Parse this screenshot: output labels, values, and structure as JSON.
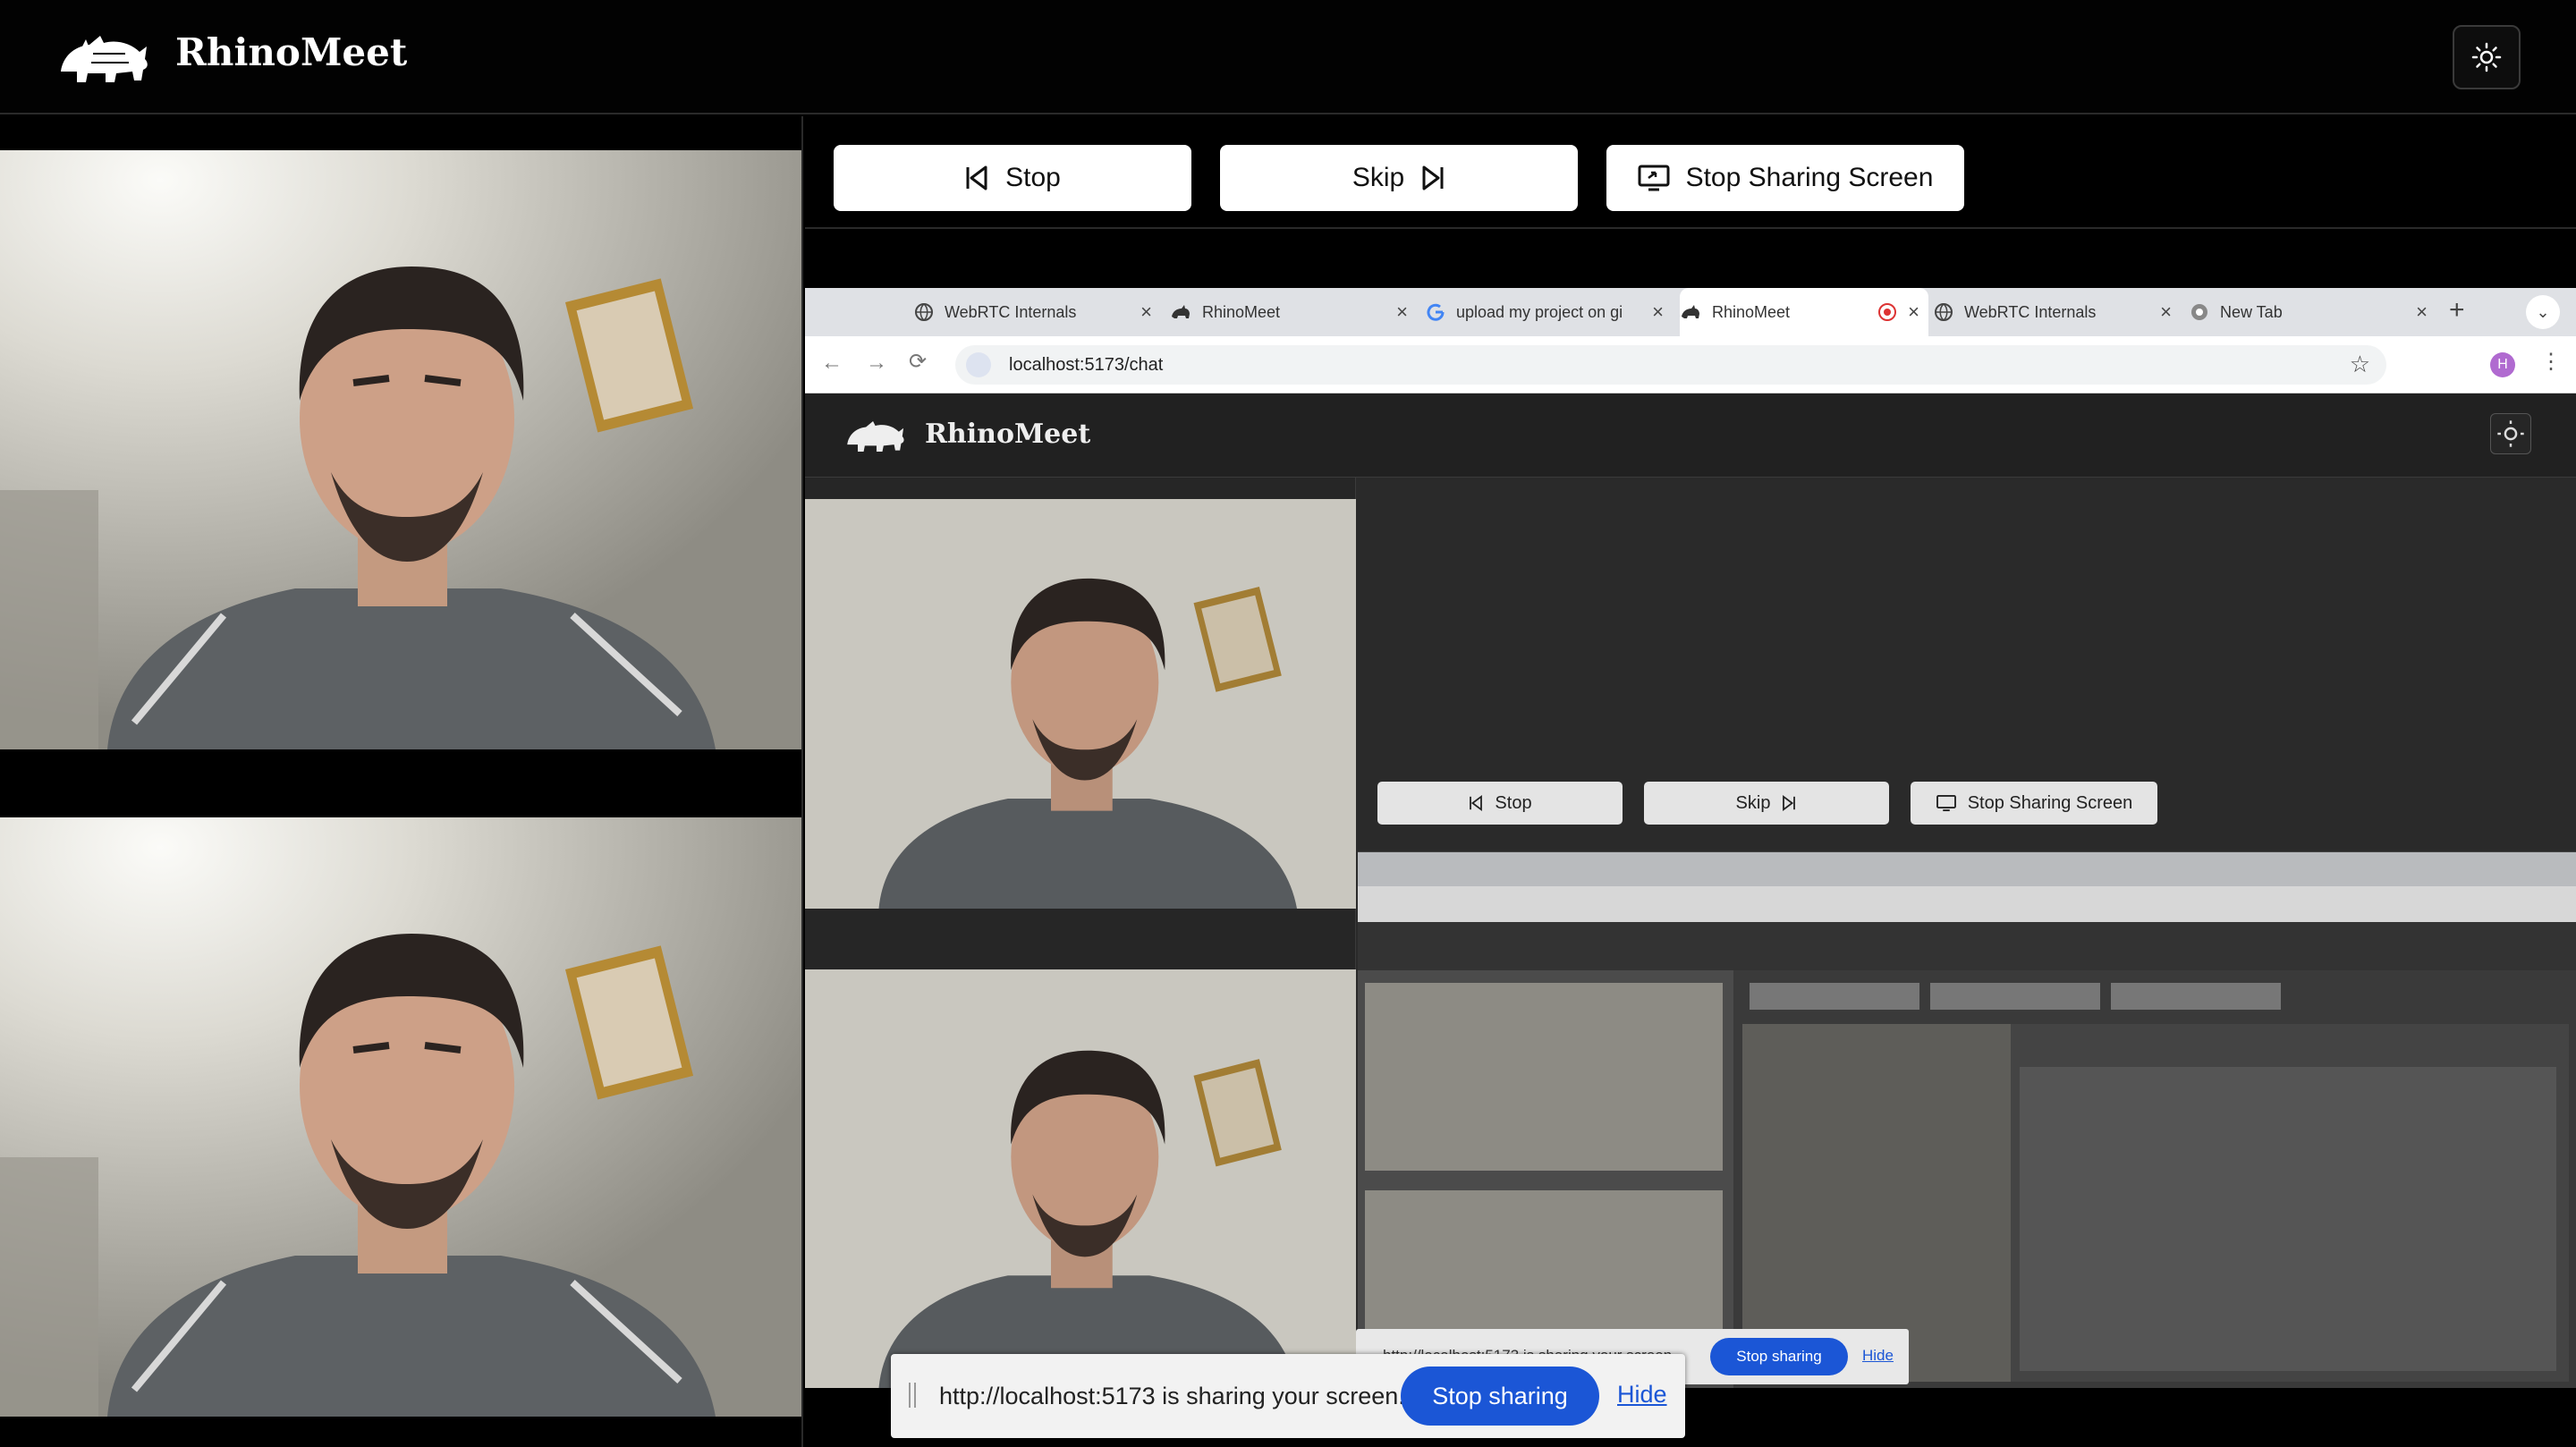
{
  "app": {
    "name": "RhinoMeet"
  },
  "controls": {
    "stop_label": "Stop",
    "skip_label": "Skip",
    "stop_share_label": "Stop Sharing Screen"
  },
  "browser": {
    "tabs": [
      {
        "label": "WebRTC Internals",
        "icon": "globe-icon"
      },
      {
        "label": "RhinoMeet",
        "icon": "rhino-icon"
      },
      {
        "label": "upload my project on gi",
        "icon": "google-icon"
      },
      {
        "label": "RhinoMeet",
        "icon": "rhino-icon"
      },
      {
        "label": "WebRTC Internals",
        "icon": "globe-icon"
      },
      {
        "label": "New Tab",
        "icon": "chrome-icon"
      }
    ],
    "url": "localhost:5173/chat",
    "profile_initial": "H"
  },
  "share_notification": {
    "text": "http://localhost:5173 is sharing your screen.",
    "stop_label": "Stop sharing",
    "hide_label": "Hide"
  },
  "colors": {
    "background": "#000000",
    "button": "#ffffff",
    "accent_blue": "#1b56d6",
    "skin": "#c9a08a"
  }
}
